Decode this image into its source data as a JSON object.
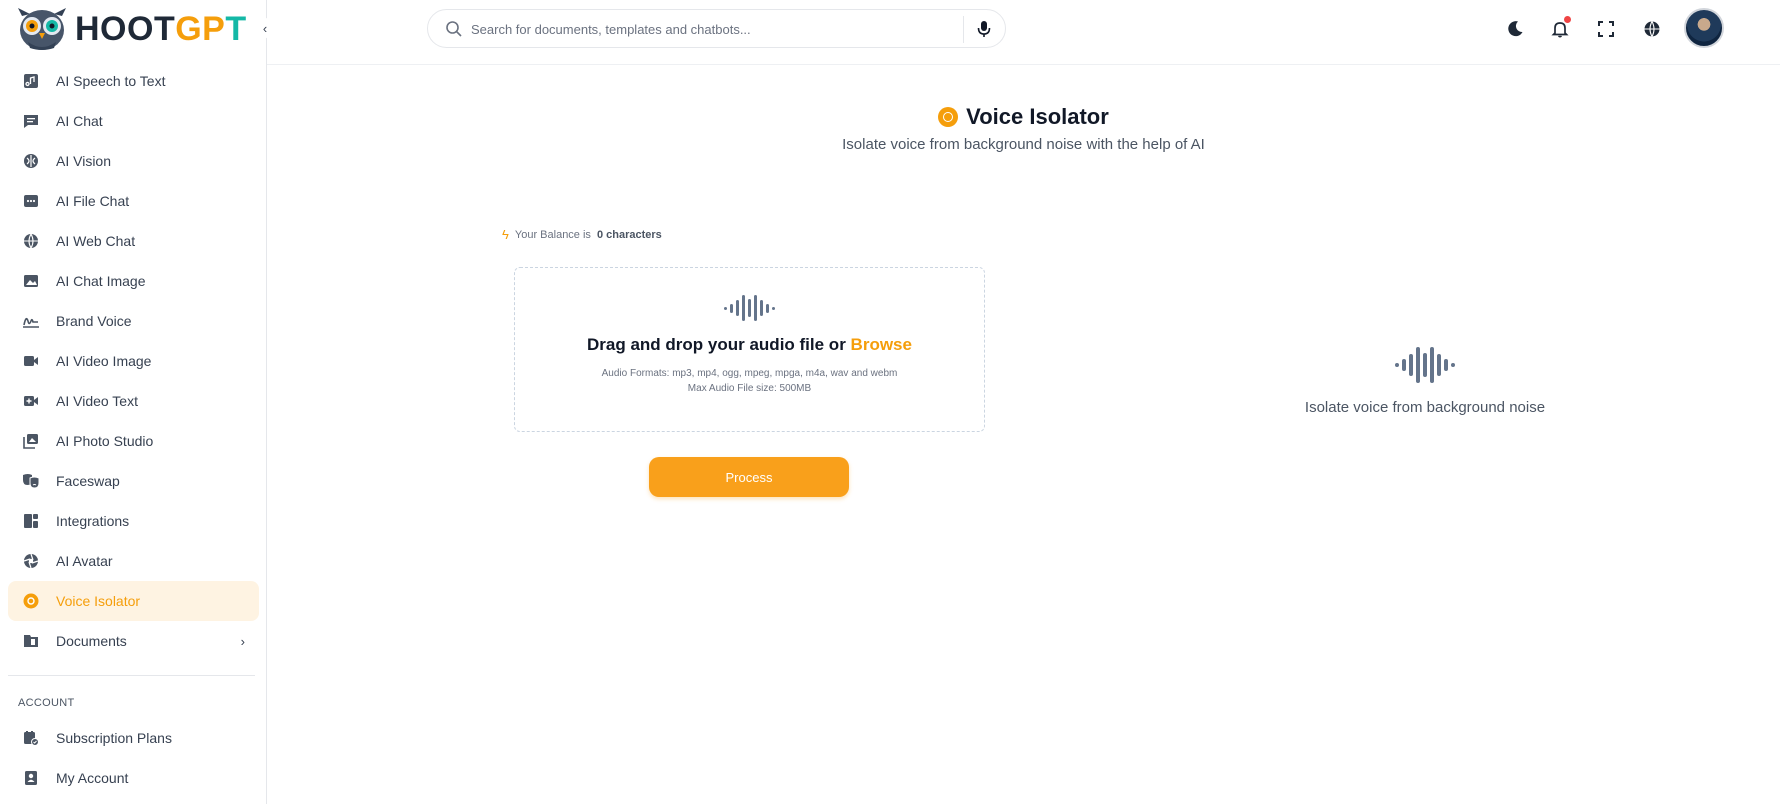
{
  "app": {
    "logo_part1": "HOOT",
    "logo_g": "G",
    "logo_p": "P",
    "logo_t": "T"
  },
  "sidebar": {
    "items": [
      {
        "label": "AI Speech to Text",
        "icon": "speech-to-text-icon"
      },
      {
        "label": "AI Chat",
        "icon": "chat-icon"
      },
      {
        "label": "AI Vision",
        "icon": "vision-icon"
      },
      {
        "label": "AI File Chat",
        "icon": "file-chat-icon"
      },
      {
        "label": "AI Web Chat",
        "icon": "globe-icon"
      },
      {
        "label": "AI Chat Image",
        "icon": "image-icon"
      },
      {
        "label": "Brand Voice",
        "icon": "signature-icon"
      },
      {
        "label": "AI Video Image",
        "icon": "video-icon"
      },
      {
        "label": "AI Video Text",
        "icon": "video-plus-icon"
      },
      {
        "label": "AI Photo Studio",
        "icon": "photo-studio-icon"
      },
      {
        "label": "Faceswap",
        "icon": "masks-icon"
      },
      {
        "label": "Integrations",
        "icon": "integrations-icon"
      },
      {
        "label": "AI Avatar",
        "icon": "aperture-icon"
      },
      {
        "label": "Voice Isolator",
        "icon": "voice-isolator-icon",
        "active": true
      },
      {
        "label": "Documents",
        "icon": "folder-icon",
        "has_submenu": true
      }
    ],
    "account_section_label": "ACCOUNT",
    "account_items": [
      {
        "label": "Subscription Plans",
        "icon": "subscription-icon"
      },
      {
        "label": "My Account",
        "icon": "account-icon"
      }
    ]
  },
  "topbar": {
    "search_placeholder": "Search for documents, templates and chatbots..."
  },
  "page": {
    "title": "Voice Isolator",
    "subtitle": "Isolate voice from background noise with the help of AI"
  },
  "balance": {
    "prefix": "Your Balance is",
    "value": "0 characters"
  },
  "dropzone": {
    "title": "Drag and drop your audio file or",
    "browse": "Browse",
    "formats": "Audio Formats: mp3, mp4, ogg, mpeg, mpga, m4a, wav and webm",
    "max_size": "Max Audio File size: 500MB"
  },
  "process_button": "Process",
  "empty_state": {
    "text": "Isolate voice from background noise"
  },
  "colors": {
    "accent": "#f59e0b",
    "active_bg": "#fef3e2",
    "notification_dot": "#ef4444"
  }
}
